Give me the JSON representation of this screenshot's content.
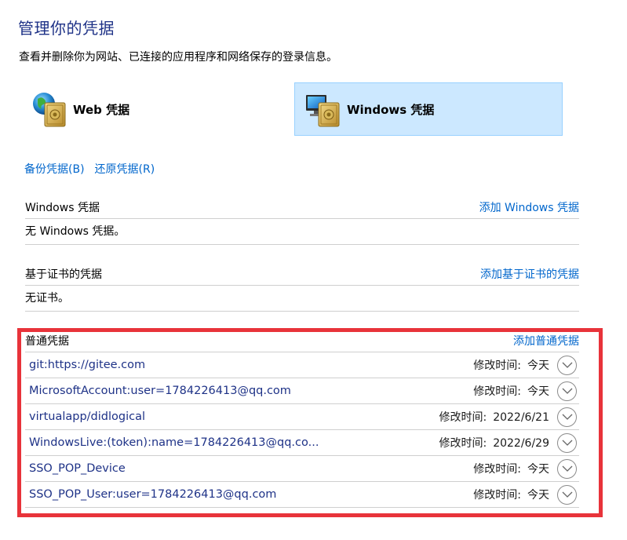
{
  "header": {
    "title": "管理你的凭据",
    "description": "查看并删除你为网站、已连接的应用程序和网络保存的登录信息。"
  },
  "credential_types": {
    "web_label": "Web 凭据",
    "windows_label": "Windows 凭据",
    "selected": "windows"
  },
  "actions": {
    "backup": "备份凭据(B)",
    "restore": "还原凭据(R)"
  },
  "windows_section": {
    "title": "Windows 凭据",
    "add_link": "添加 Windows 凭据",
    "empty_text": "无 Windows 凭据。"
  },
  "cert_section": {
    "title": "基于证书的凭据",
    "add_link": "添加基于证书的凭据",
    "empty_text": "无证书。"
  },
  "general_section": {
    "title": "普通凭据",
    "add_link": "添加普通凭据",
    "items": [
      {
        "name": "git:https://gitee.com",
        "modified_label": "修改时间:",
        "modified_value": "今天"
      },
      {
        "name": "MicrosoftAccount:user=1784226413@qq.com",
        "modified_label": "修改时间:",
        "modified_value": "今天"
      },
      {
        "name": "virtualapp/didlogical",
        "modified_label": "修改时间:",
        "modified_value": "2022/6/21"
      },
      {
        "name": "WindowsLive:(token):name=1784226413@qq.co...",
        "modified_label": "修改时间:",
        "modified_value": "2022/6/29"
      },
      {
        "name": "SSO_POP_Device",
        "modified_label": "修改时间:",
        "modified_value": "今天"
      },
      {
        "name": "SSO_POP_User:user=1784226413@qq.com",
        "modified_label": "修改时间:",
        "modified_value": "今天"
      }
    ]
  },
  "colors": {
    "title": "#1e3287",
    "link": "#0066cc",
    "selected_card_bg": "#cce8ff",
    "highlight_border": "#e8333a"
  }
}
